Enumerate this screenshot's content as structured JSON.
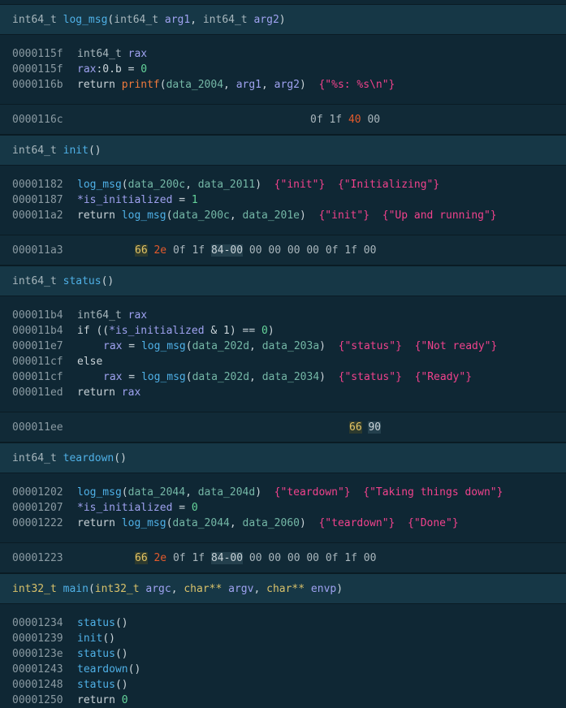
{
  "blocks": [
    {
      "kind": "func",
      "signature": [
        [
          "ty",
          "int64_t "
        ],
        [
          "fn",
          "log_msg"
        ],
        [
          "txt",
          "("
        ],
        [
          "ty",
          "int64_t "
        ],
        [
          "var",
          "arg1"
        ],
        [
          "txt",
          ", "
        ],
        [
          "ty",
          "int64_t "
        ],
        [
          "var",
          "arg2"
        ],
        [
          "txt",
          ")"
        ]
      ],
      "lines": [
        {
          "addr": "0000115f",
          "parts": [
            [
              "ty",
              "int64_t "
            ],
            [
              "var",
              "rax"
            ]
          ]
        },
        {
          "addr": "0000115f",
          "parts": [
            [
              "var",
              "rax"
            ],
            [
              "txt",
              ":0.b = "
            ],
            [
              "num",
              "0"
            ]
          ]
        },
        {
          "addr": "0000116b",
          "parts": [
            [
              "txt",
              "return "
            ],
            [
              "call-pf",
              "printf"
            ],
            [
              "txt",
              "("
            ],
            [
              "dataref",
              "data_2004"
            ],
            [
              "txt",
              ", "
            ],
            [
              "var",
              "arg1"
            ],
            [
              "txt",
              ", "
            ],
            [
              "var",
              "arg2"
            ],
            [
              "txt",
              ")  "
            ],
            [
              "str",
              "{\"%s: %s\\n\"}"
            ]
          ]
        }
      ]
    },
    {
      "kind": "hex",
      "addr": "0000116c",
      "bytes": [
        [
          "n",
          "0f 1f "
        ],
        [
          "o",
          "40"
        ],
        [
          "n",
          " 00"
        ]
      ],
      "offset": "382"
    },
    {
      "kind": "func",
      "signature": [
        [
          "ty",
          "int64_t "
        ],
        [
          "fn",
          "init"
        ],
        [
          "txt",
          "()"
        ]
      ],
      "lines": [
        {
          "addr": "00001182",
          "parts": [
            [
              "fn",
              "log_msg"
            ],
            [
              "txt",
              "("
            ],
            [
              "dataref",
              "data_200c"
            ],
            [
              "txt",
              ", "
            ],
            [
              "dataref",
              "data_2011"
            ],
            [
              "txt",
              ")  "
            ],
            [
              "str",
              "{\"init\"}"
            ],
            [
              "txt",
              "  "
            ],
            [
              "str",
              "{\"Initializing\"}"
            ]
          ]
        },
        {
          "addr": "00001187",
          "parts": [
            [
              "var",
              "*is_initialized"
            ],
            [
              "txt",
              " = "
            ],
            [
              "num",
              "1"
            ]
          ]
        },
        {
          "addr": "000011a2",
          "parts": [
            [
              "txt",
              "return "
            ],
            [
              "fn",
              "log_msg"
            ],
            [
              "txt",
              "("
            ],
            [
              "dataref",
              "data_200c"
            ],
            [
              "txt",
              ", "
            ],
            [
              "dataref",
              "data_201e"
            ],
            [
              "txt",
              ")  "
            ],
            [
              "str",
              "{\"init\"}"
            ],
            [
              "txt",
              "  "
            ],
            [
              "str",
              "{\"Up and running\"}"
            ]
          ]
        }
      ]
    },
    {
      "kind": "hex",
      "addr": "000011a3",
      "bytes": [
        [
          "y",
          "66"
        ],
        [
          "n",
          " "
        ],
        [
          "o",
          "2e"
        ],
        [
          "n",
          " 0f 1f "
        ],
        [
          "b",
          "84-00"
        ],
        [
          "n",
          " 00 00 00 00 0f 1f 00"
        ]
      ],
      "offset": "166"
    },
    {
      "kind": "func",
      "signature": [
        [
          "ty",
          "int64_t "
        ],
        [
          "fn",
          "status"
        ],
        [
          "txt",
          "()"
        ]
      ],
      "lines": [
        {
          "addr": "000011b4",
          "parts": [
            [
              "ty",
              "int64_t "
            ],
            [
              "var",
              "rax"
            ]
          ]
        },
        {
          "addr": "000011b4",
          "parts": [
            [
              "txt",
              "if (("
            ],
            [
              "var",
              "*is_initialized"
            ],
            [
              "txt",
              " & 1) == "
            ],
            [
              "num",
              "0"
            ],
            [
              "txt",
              ")"
            ]
          ]
        },
        {
          "addr": "000011e7",
          "indent": 1,
          "parts": [
            [
              "var",
              "rax"
            ],
            [
              "txt",
              " = "
            ],
            [
              "fn",
              "log_msg"
            ],
            [
              "txt",
              "("
            ],
            [
              "dataref",
              "data_202d"
            ],
            [
              "txt",
              ", "
            ],
            [
              "dataref",
              "data_203a"
            ],
            [
              "txt",
              ")  "
            ],
            [
              "str",
              "{\"status\"}"
            ],
            [
              "txt",
              "  "
            ],
            [
              "str",
              "{\"Not ready\"}"
            ]
          ]
        },
        {
          "addr": "000011cf",
          "parts": [
            [
              "txt",
              "else"
            ]
          ]
        },
        {
          "addr": "000011cf",
          "indent": 1,
          "parts": [
            [
              "var",
              "rax"
            ],
            [
              "txt",
              " = "
            ],
            [
              "fn",
              "log_msg"
            ],
            [
              "txt",
              "("
            ],
            [
              "dataref",
              "data_202d"
            ],
            [
              "txt",
              ", "
            ],
            [
              "dataref",
              "data_2034"
            ],
            [
              "txt",
              ")  "
            ],
            [
              "str",
              "{\"status\"}"
            ],
            [
              "txt",
              "  "
            ],
            [
              "str",
              "{\"Ready\"}"
            ]
          ]
        },
        {
          "addr": "000011ed",
          "parts": [
            [
              "txt",
              "return "
            ],
            [
              "var",
              "rax"
            ]
          ]
        }
      ]
    },
    {
      "kind": "hex",
      "addr": "000011ee",
      "bytes": [
        [
          "y",
          "66"
        ],
        [
          "n",
          " "
        ],
        [
          "b",
          "90"
        ]
      ],
      "offset": "430"
    },
    {
      "kind": "func",
      "signature": [
        [
          "ty",
          "int64_t "
        ],
        [
          "fn",
          "teardown"
        ],
        [
          "txt",
          "()"
        ]
      ],
      "lines": [
        {
          "addr": "00001202",
          "parts": [
            [
              "fn",
              "log_msg"
            ],
            [
              "txt",
              "("
            ],
            [
              "dataref",
              "data_2044"
            ],
            [
              "txt",
              ", "
            ],
            [
              "dataref",
              "data_204d"
            ],
            [
              "txt",
              ")  "
            ],
            [
              "str",
              "{\"teardown\"}"
            ],
            [
              "txt",
              "  "
            ],
            [
              "str",
              "{\"Taking things down\"}"
            ]
          ]
        },
        {
          "addr": "00001207",
          "parts": [
            [
              "var",
              "*is_initialized"
            ],
            [
              "txt",
              " = "
            ],
            [
              "num",
              "0"
            ]
          ]
        },
        {
          "addr": "00001222",
          "parts": [
            [
              "txt",
              "return "
            ],
            [
              "fn",
              "log_msg"
            ],
            [
              "txt",
              "("
            ],
            [
              "dataref",
              "data_2044"
            ],
            [
              "txt",
              ", "
            ],
            [
              "dataref",
              "data_2060"
            ],
            [
              "txt",
              ")  "
            ],
            [
              "str",
              "{\"teardown\"}"
            ],
            [
              "txt",
              "  "
            ],
            [
              "str",
              "{\"Done\"}"
            ]
          ]
        }
      ]
    },
    {
      "kind": "hex",
      "addr": "00001223",
      "bytes": [
        [
          "y",
          "66"
        ],
        [
          "n",
          " "
        ],
        [
          "o",
          "2e"
        ],
        [
          "n",
          " 0f 1f "
        ],
        [
          "b",
          "84-00"
        ],
        [
          "n",
          " 00 00 00 00 0f 1f 00"
        ]
      ],
      "offset": "166"
    },
    {
      "kind": "func",
      "signature": [
        [
          "brace",
          "int32_t "
        ],
        [
          "fn",
          "main"
        ],
        [
          "txt",
          "("
        ],
        [
          "brace",
          "int32_t "
        ],
        [
          "var",
          "argc"
        ],
        [
          "txt",
          ", "
        ],
        [
          "brace",
          "char** "
        ],
        [
          "var",
          "argv"
        ],
        [
          "txt",
          ", "
        ],
        [
          "brace",
          "char** "
        ],
        [
          "var",
          "envp"
        ],
        [
          "txt",
          ")"
        ]
      ],
      "lines": [
        {
          "addr": "00001234",
          "parts": [
            [
              "fn",
              "status"
            ],
            [
              "txt",
              "()"
            ]
          ]
        },
        {
          "addr": "00001239",
          "parts": [
            [
              "fn",
              "init"
            ],
            [
              "txt",
              "()"
            ]
          ]
        },
        {
          "addr": "0000123e",
          "parts": [
            [
              "fn",
              "status"
            ],
            [
              "txt",
              "()"
            ]
          ]
        },
        {
          "addr": "00001243",
          "parts": [
            [
              "fn",
              "teardown"
            ],
            [
              "txt",
              "()"
            ]
          ]
        },
        {
          "addr": "00001248",
          "parts": [
            [
              "fn",
              "status"
            ],
            [
              "txt",
              "()"
            ]
          ]
        },
        {
          "addr": "00001250",
          "parts": [
            [
              "txt",
              "return "
            ],
            [
              "num",
              "0"
            ]
          ]
        }
      ]
    }
  ]
}
